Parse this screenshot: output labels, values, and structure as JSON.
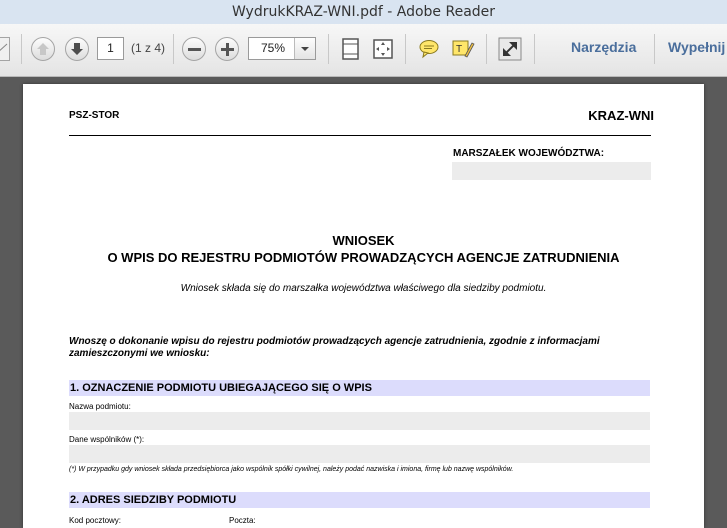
{
  "window": {
    "title": "WydrukKRAZ-WNI.pdf - Adobe Reader"
  },
  "toolbar": {
    "page_current": "1",
    "page_count": "(1 z 4)",
    "zoom": "75%",
    "tools_label": "Narzędzia",
    "fill_label": "Wypełnij"
  },
  "document": {
    "header_left": "PSZ-STOR",
    "header_right": "KRAZ-WNI",
    "marszalek_label": "MARSZAŁEK WOJEWÓDZTWA:",
    "title_line1": "WNIOSEK",
    "title_line2": "O WPIS DO REJESTRU PODMIOTÓW PROWADZĄCYCH AGENCJE ZATRUDNIENIA",
    "subtitle": "Wniosek składa się do marszałka województwa właściwego dla siedziby podmiotu.",
    "request_line1": "Wnoszę o dokonanie wpisu do rejestru podmiotów prowadzących agencje zatrudnienia, zgodnie z informacjami",
    "request_line2": "zamieszczonymi we wniosku:",
    "section1_title": "1. OZNACZENIE PODMIOTU UBIEGAJĄCEGO SIĘ O WPIS",
    "field_name_label": "Nazwa podmiotu:",
    "field_partners_label": "Dane wspólników (*):",
    "footnote": "(*) W przypadku gdy wniosek składa przedsiębiorca jako wspólnik spółki cywilnej, należy podać nazwiska i imiona, firmę lub nazwę wspólników.",
    "section2_title": "2. ADRES SIEDZIBY PODMIOTU",
    "postal_code_label": "Kod pocztowy:",
    "post_label": "Poczta:"
  }
}
